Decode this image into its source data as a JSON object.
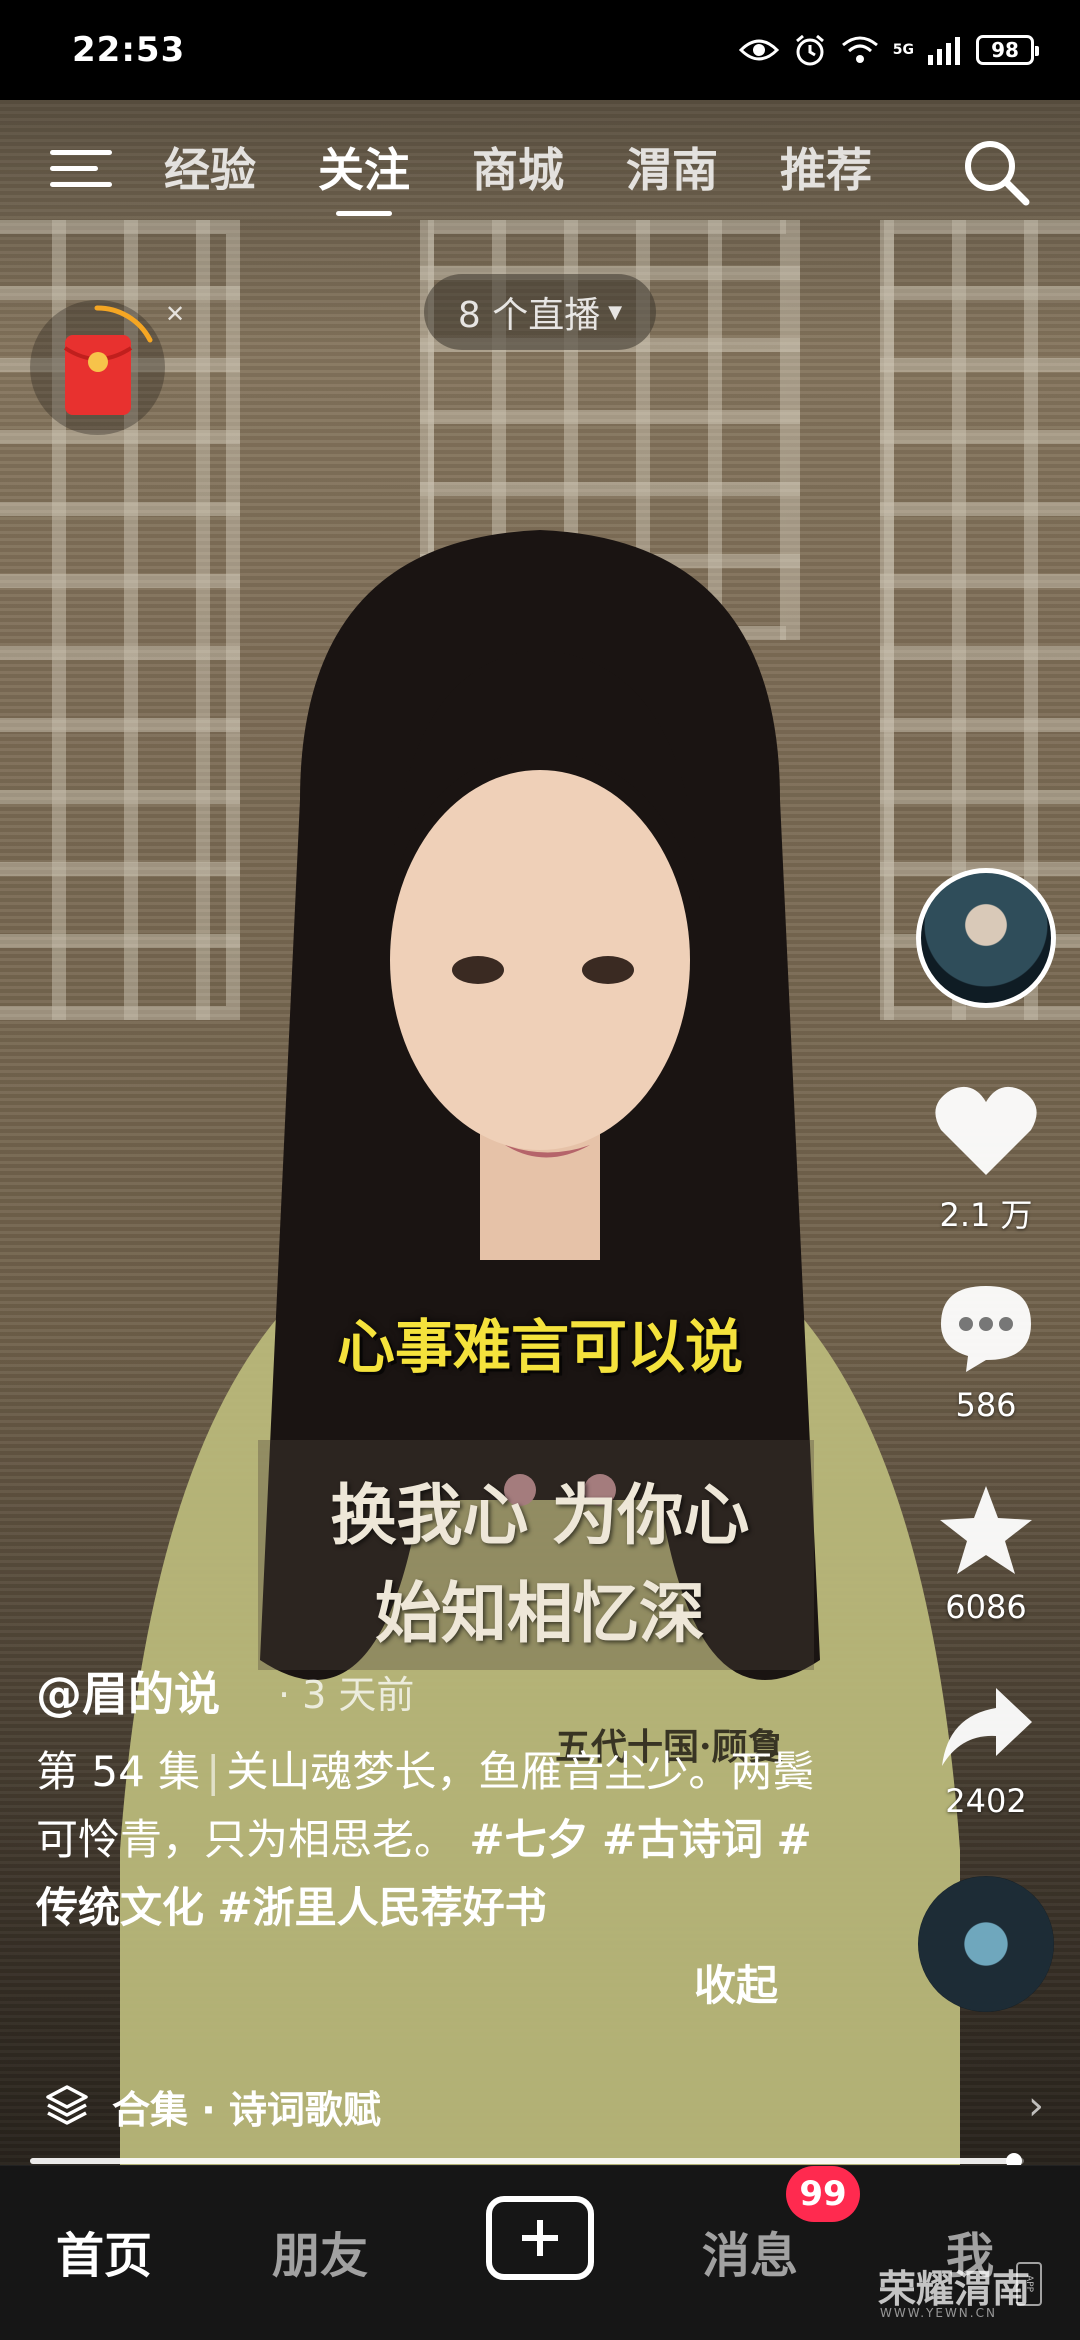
{
  "status_bar": {
    "time": "22:53",
    "network": "5G",
    "battery": "98"
  },
  "top_nav": {
    "tabs": [
      {
        "label": "经验"
      },
      {
        "label": "关注"
      },
      {
        "label": "商城"
      },
      {
        "label": "渭南"
      },
      {
        "label": "推荐"
      }
    ],
    "active_tab": "关注",
    "icons": [
      "menu-icon",
      "search-icon"
    ]
  },
  "live_pill": {
    "label": "8 个直播"
  },
  "video": {
    "subtitle_main": "心事难言可以说",
    "poem_line1": "换我心  为你心",
    "poem_line2": "始知相忆深",
    "poem_source": "五代十国·顾敻"
  },
  "rail": {
    "likes": "2.1 万",
    "comments": "586",
    "favorites": "6086",
    "shares": "2402"
  },
  "caption": {
    "author": "@眉的说",
    "posted": "· 3 天前",
    "episode": "第 54 集",
    "text": "关山魂梦长，鱼雁音尘少。两鬓可怜青，只为相思老。",
    "tags": [
      "#七夕",
      "#古诗词",
      "#传统文化",
      "#浙里人民荐好书"
    ],
    "collapse": "收起"
  },
  "collection": {
    "label": "合集 · 诗词歌赋"
  },
  "progress": {
    "fraction": 0.99
  },
  "bottom_nav": {
    "home": "首页",
    "friends": "朋友",
    "messages": "消息",
    "messages_badge": "99",
    "me": "我"
  },
  "watermark": {
    "brand": "荣耀渭南",
    "url": "WWW.YEWN.CN",
    "app": "APP"
  },
  "colors": {
    "subtitle_yellow": "#f4e23c",
    "badge_red": "#ff2a4f",
    "nav_bg": "#161616"
  }
}
